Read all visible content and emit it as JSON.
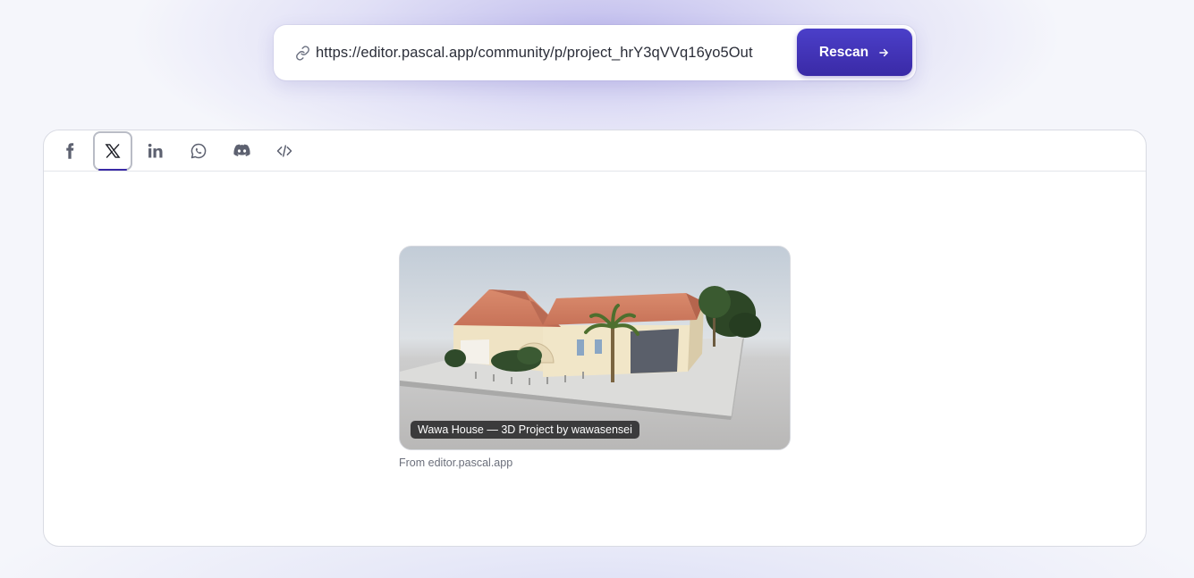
{
  "url_bar": {
    "url": "https://editor.pascal.app/community/p/project_hrY3qVVq16yo5Out",
    "icon": "link-icon",
    "rescan_label": "Rescan"
  },
  "tabs": [
    {
      "name": "facebook",
      "icon": "facebook-icon",
      "active": false
    },
    {
      "name": "x",
      "icon": "x-icon",
      "active": true
    },
    {
      "name": "linkedin",
      "icon": "linkedin-icon",
      "active": false
    },
    {
      "name": "whatsapp",
      "icon": "whatsapp-icon",
      "active": false
    },
    {
      "name": "discord",
      "icon": "discord-icon",
      "active": false
    },
    {
      "name": "embed",
      "icon": "code-icon",
      "active": false
    }
  ],
  "preview": {
    "caption": "Wawa House — 3D Project by wawasensei",
    "source": "From editor.pascal.app"
  },
  "colors": {
    "accent": "#3a2aa6",
    "accent_light": "#4b3fc9"
  }
}
